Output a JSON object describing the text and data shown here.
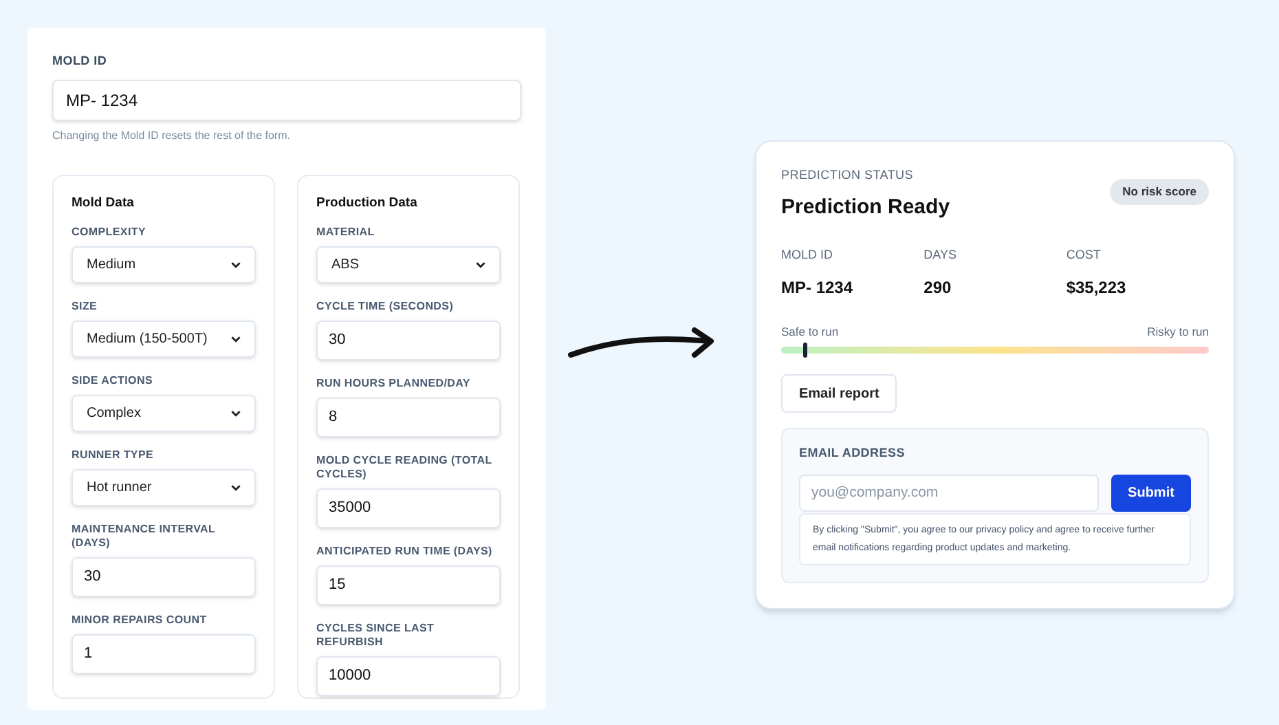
{
  "mold_id": {
    "label": "MOLD ID",
    "value": "MP- 1234",
    "hint": "Changing the Mold ID resets the rest of the form."
  },
  "sections": [
    {
      "title": "Mold Data",
      "fields": [
        {
          "kind": "select",
          "label": "COMPLEXITY",
          "value": "Medium"
        },
        {
          "kind": "select",
          "label": "SIZE",
          "value": "Medium (150-500T)"
        },
        {
          "kind": "select",
          "label": "SIDE ACTIONS",
          "value": "Complex"
        },
        {
          "kind": "select",
          "label": "RUNNER TYPE",
          "value": "Hot runner"
        },
        {
          "kind": "input",
          "label": "MAINTENANCE INTERVAL (DAYS)",
          "value": "30"
        },
        {
          "kind": "input",
          "label": "MINOR REPAIRS COUNT",
          "value": "1"
        }
      ]
    },
    {
      "title": "Production Data",
      "fields": [
        {
          "kind": "select",
          "label": "MATERIAL",
          "value": "ABS"
        },
        {
          "kind": "input",
          "label": "CYCLE TIME (SECONDS)",
          "value": "30"
        },
        {
          "kind": "input",
          "label": "RUN HOURS PLANNED/DAY",
          "value": "8"
        },
        {
          "kind": "input",
          "label": "MOLD CYCLE READING (TOTAL CYCLES)",
          "value": "35000"
        },
        {
          "kind": "input",
          "label": "ANTICIPATED RUN TIME (DAYS)",
          "value": "15"
        },
        {
          "kind": "input",
          "label": "CYCLES SINCE LAST REFURBISH",
          "value": "10000"
        }
      ]
    }
  ],
  "prediction": {
    "eyebrow": "PREDICTION STATUS",
    "title": "Prediction Ready",
    "badge": "No risk score",
    "stats": [
      {
        "label": "MOLD ID",
        "value": "MP- 1234"
      },
      {
        "label": "DAYS",
        "value": "290"
      },
      {
        "label": "COST",
        "value": "$35,223"
      }
    ],
    "meter": {
      "low_label": "Safe to run",
      "high_label": "Risky to run",
      "level": 0.055
    },
    "email_button": "Email report",
    "email_form": {
      "label": "EMAIL ADDRESS",
      "placeholder": "you@company.com",
      "submit": "Submit",
      "disclaimer": "By clicking \"Submit\", you agree to our privacy policy and agree to receive further email notifications regarding product updates and marketing."
    }
  }
}
